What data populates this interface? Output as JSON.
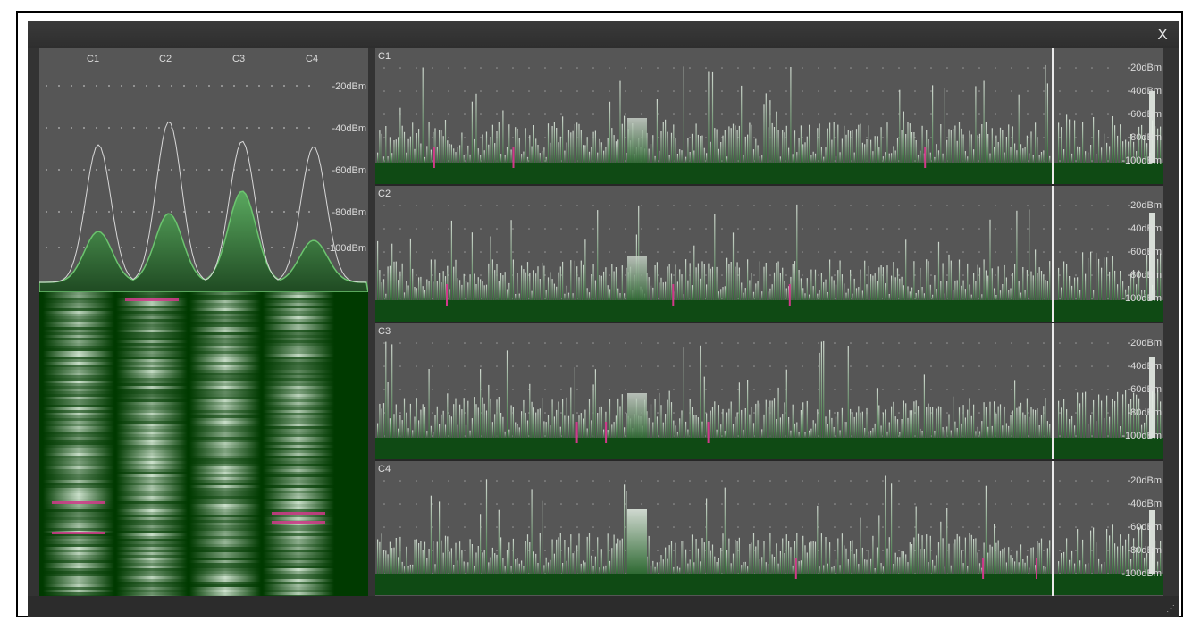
{
  "window": {
    "close_label": "X",
    "resize_grip": "⋰"
  },
  "left": {
    "channels": [
      "C1",
      "C2",
      "C3",
      "C4"
    ],
    "db_levels": [
      "-20dBm",
      "-40dBm",
      "-60dBm",
      "-80dBm",
      "-100dBm"
    ]
  },
  "rows": [
    {
      "label": "C1",
      "db_levels": [
        "-20dBm",
        "-40dBm",
        "-60dBm",
        "-80dBm",
        "-100dBm"
      ]
    },
    {
      "label": "C2",
      "db_levels": [
        "-20dBm",
        "-40dBm",
        "-60dBm",
        "-80dBm",
        "-100dBm"
      ]
    },
    {
      "label": "C3",
      "db_levels": [
        "-20dBm",
        "-40dBm",
        "-60dBm",
        "-80dBm",
        "-100dBm"
      ]
    },
    {
      "label": "C4",
      "db_levels": [
        "-20dBm",
        "-40dBm",
        "-60dBm",
        "-80dBm",
        "-100dBm"
      ]
    }
  ],
  "colors": {
    "trace": "#d8d8d8",
    "fill_green": "#4f9a55",
    "marker": "#d03a8a",
    "bg": "#565656"
  },
  "icons": {
    "close": "close-icon",
    "resize": "resize-grip-icon"
  }
}
